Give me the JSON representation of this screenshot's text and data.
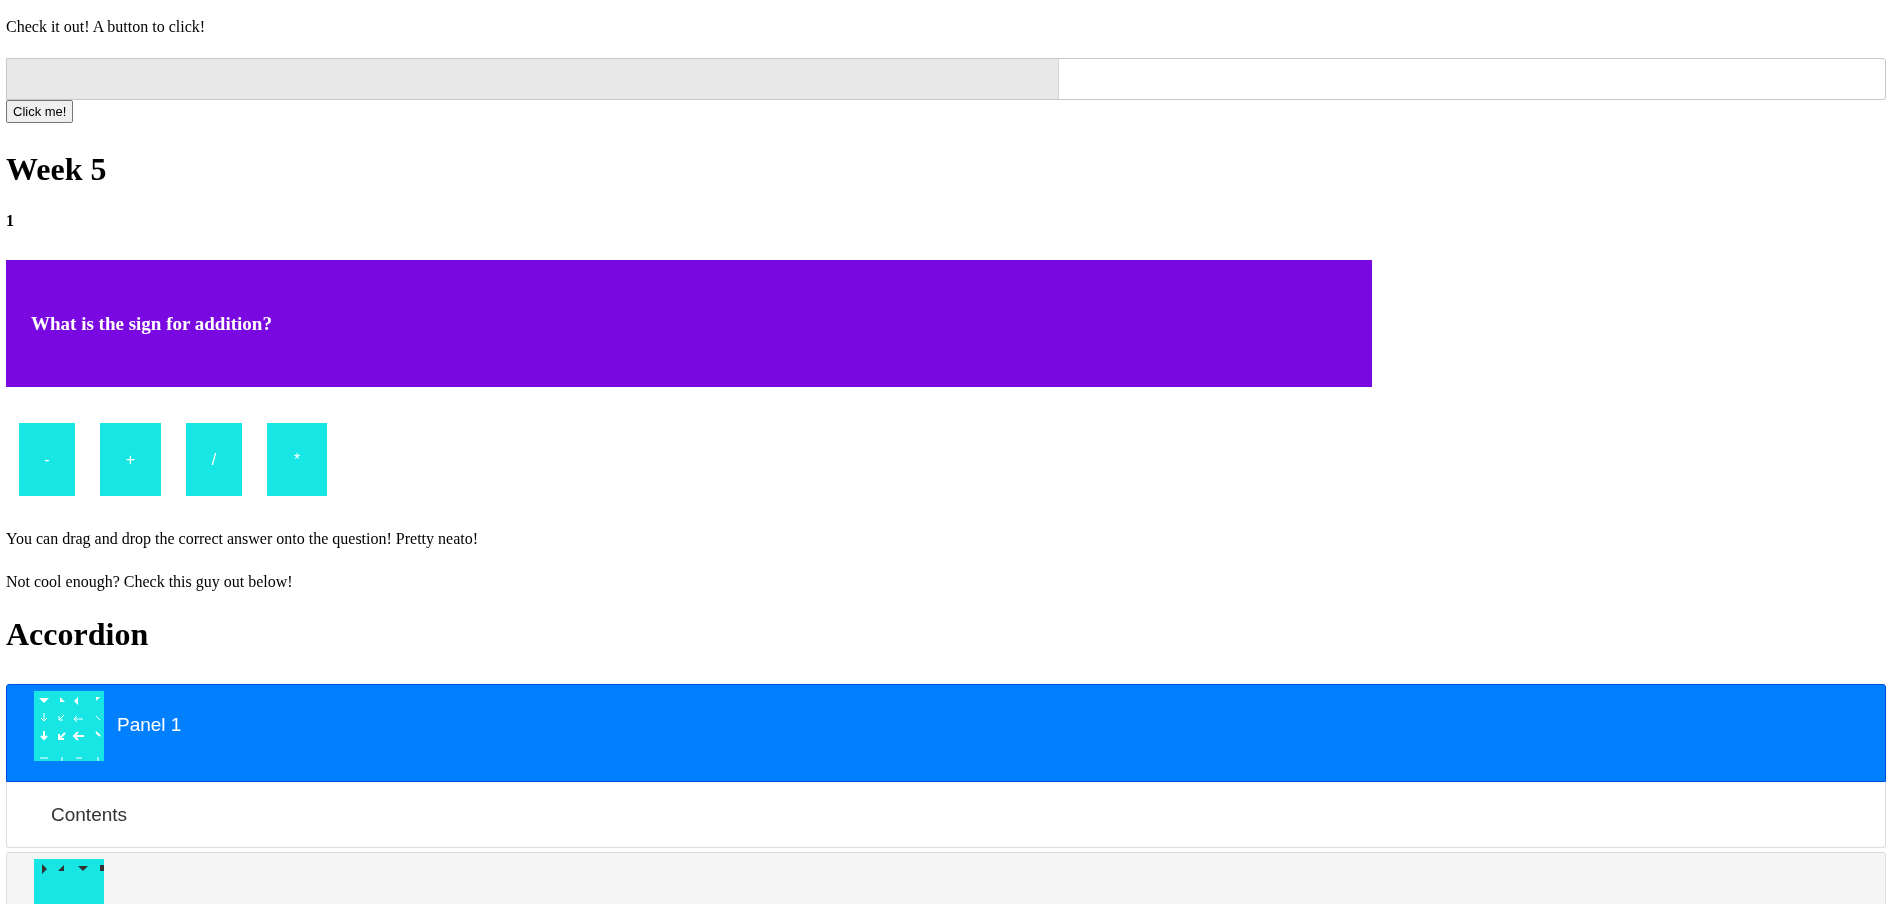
{
  "intro": "Check it out! A button to click!",
  "progress": {
    "level": 0.56
  },
  "button": "Click me!",
  "heading": "Week 5",
  "question_number": "1",
  "question": "What is the sign for addition?",
  "answers": [
    {
      "label": "-"
    },
    {
      "label": "+"
    },
    {
      "label": "/"
    },
    {
      "label": "*"
    }
  ],
  "notes": [
    "You can drag and drop the correct answer onto the question! Pretty neato!",
    "Not cool enough? Check this guy out below!"
  ],
  "accordion_heading": "Accordion",
  "panels": [
    {
      "title": "Panel 1",
      "expanded": true,
      "content": "Contents"
    },
    {
      "expanded": false
    }
  ]
}
